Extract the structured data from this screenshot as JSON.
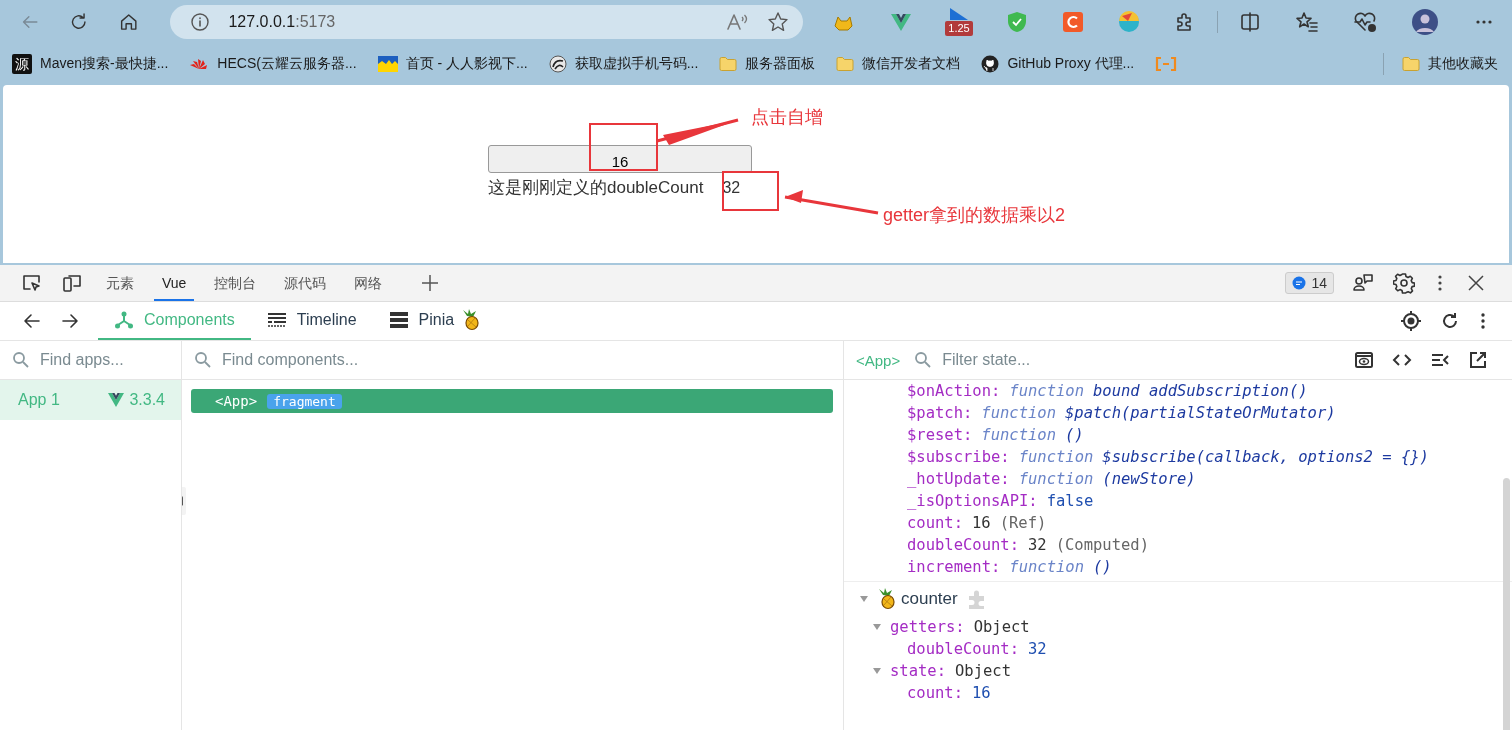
{
  "browser": {
    "url_host": "127.0.0.1",
    "url_port": ":5173",
    "extension_badge": "1.25"
  },
  "bookmarks": [
    {
      "kind": "text",
      "icon_text": "源",
      "label": "Maven搜索-最快捷..."
    },
    {
      "kind": "fan",
      "label": "HECS(云耀云服务器..."
    },
    {
      "kind": "waves",
      "label": "首页 - 人人影视下..."
    },
    {
      "kind": "swirl",
      "label": "获取虚拟手机号码..."
    },
    {
      "kind": "folder",
      "label": "服务器面板"
    },
    {
      "kind": "folder",
      "label": "微信开发者文档"
    },
    {
      "kind": "github",
      "label": "GitHub Proxy 代理..."
    },
    {
      "kind": "bracket"
    }
  ],
  "other_bookmarks": {
    "label": "其他收藏夹"
  },
  "page": {
    "counter_button": "16",
    "double_label": "这是刚刚定义的doubleCount",
    "double_value": "32",
    "annotations": [
      {
        "text": "点击自增",
        "kind": "button"
      },
      {
        "text": "getter拿到的数据乘以2",
        "kind": "value"
      }
    ]
  },
  "devtools": {
    "tabs": [
      {
        "label": "元素",
        "selected": false
      },
      {
        "label": "Vue",
        "selected": true
      },
      {
        "label": "控制台",
        "selected": false
      },
      {
        "label": "源代码",
        "selected": false
      },
      {
        "label": "网络",
        "selected": false
      }
    ],
    "issues": "14",
    "vue_tabs": [
      {
        "label": "Components",
        "kind": "components",
        "selected": true
      },
      {
        "label": "Timeline",
        "kind": "timeline",
        "selected": false
      },
      {
        "label": "Pinia",
        "kind": "pinia",
        "selected": false,
        "logo": true
      }
    ],
    "apps": {
      "placeholder": "Find apps...",
      "items": [
        {
          "name": "App 1",
          "version": "3.3.4",
          "selected": true
        }
      ]
    },
    "components": {
      "placeholder": "Find components...",
      "items": [
        {
          "name": "<App>",
          "badge": "fragment",
          "selected": true
        }
      ]
    },
    "state": {
      "component": "<App>",
      "placeholder": "Filter state...",
      "rows": [
        {
          "key": "$onAction:",
          "kind": "function",
          "keyword": "function",
          "signature": "bound addSubscription()"
        },
        {
          "key": "$patch:",
          "kind": "function",
          "keyword": "function",
          "signature": "$patch(partialStateOrMutator)"
        },
        {
          "key": "$reset:",
          "kind": "function",
          "keyword": "function",
          "signature": "()"
        },
        {
          "key": "$subscribe:",
          "kind": "function",
          "keyword": "function",
          "signature": "$subscribe(callback, options2 = {})"
        },
        {
          "key": "_hotUpdate:",
          "kind": "function",
          "keyword": "function",
          "signature": "(newStore)"
        },
        {
          "key": "_isOptionsAPI:",
          "kind": "literal",
          "value": "false"
        },
        {
          "key": "count:",
          "kind": "plain",
          "value": "16",
          "note": "(Ref)"
        },
        {
          "key": "doubleCount:",
          "kind": "plain",
          "value": "32",
          "note": "(Computed)"
        },
        {
          "key": "increment:",
          "kind": "function",
          "keyword": "function",
          "signature": "()"
        }
      ],
      "store": {
        "name": "counter",
        "expanded": true,
        "groups": [
          {
            "key": "getters:",
            "value": "Object",
            "expanded": true,
            "children": [
              {
                "key": "doubleCount:",
                "kind": "literal",
                "value": "32"
              }
            ]
          },
          {
            "key": "state:",
            "value": "Object",
            "expanded": true,
            "children": [
              {
                "key": "count:",
                "kind": "literal",
                "value": "16"
              }
            ]
          }
        ]
      }
    }
  }
}
